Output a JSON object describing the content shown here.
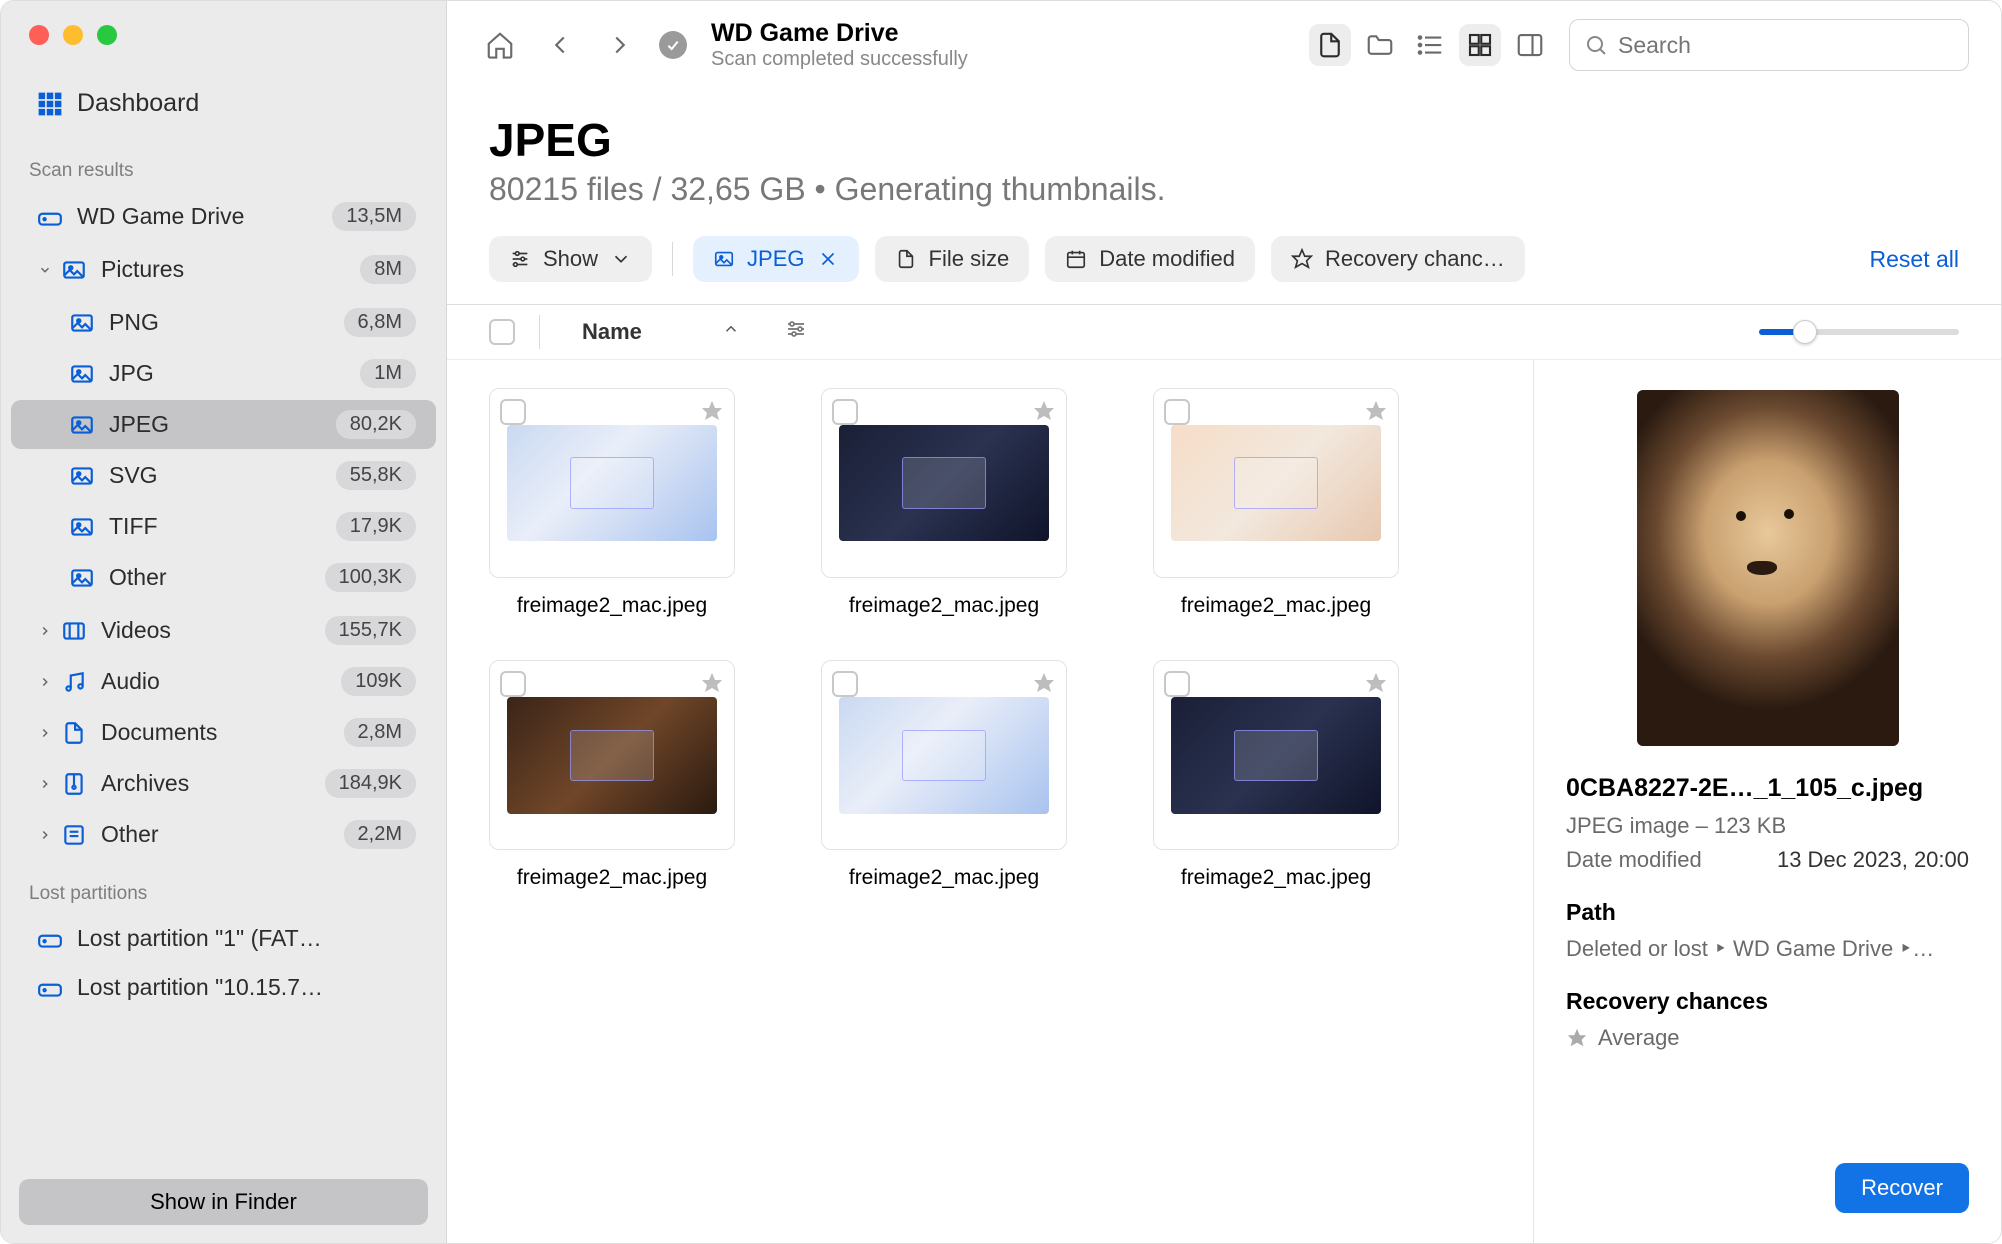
{
  "sidebar": {
    "dashboard": "Dashboard",
    "section_scan": "Scan results",
    "scan_drive": {
      "label": "WD Game Drive",
      "badge": "13,5M"
    },
    "pictures": {
      "label": "Pictures",
      "badge": "8M"
    },
    "pic_children": [
      {
        "label": "PNG",
        "badge": "6,8M"
      },
      {
        "label": "JPG",
        "badge": "1M"
      },
      {
        "label": "JPEG",
        "badge": "80,2K"
      },
      {
        "label": "SVG",
        "badge": "55,8K"
      },
      {
        "label": "TIFF",
        "badge": "17,9K"
      },
      {
        "label": "Other",
        "badge": "100,3K"
      }
    ],
    "categories": [
      {
        "label": "Videos",
        "badge": "155,7K"
      },
      {
        "label": "Audio",
        "badge": "109K"
      },
      {
        "label": "Documents",
        "badge": "2,8M"
      },
      {
        "label": "Archives",
        "badge": "184,9K"
      },
      {
        "label": "Other",
        "badge": "2,2M"
      }
    ],
    "section_lost": "Lost partitions",
    "lost": [
      "Lost partition \"1\" (FAT…",
      "Lost partition \"10.15.7…"
    ],
    "show_finder": "Show in Finder"
  },
  "toolbar": {
    "title": "WD Game Drive",
    "subtitle": "Scan completed successfully",
    "search_placeholder": "Search"
  },
  "header": {
    "title": "JPEG",
    "subtitle": "80215 files / 32,65 GB • Generating thumbnails."
  },
  "filters": {
    "show": "Show",
    "jpeg": "JPEG",
    "file_size": "File size",
    "date_modified": "Date modified",
    "recovery": "Recovery chanc…",
    "reset": "Reset all"
  },
  "list_header": {
    "name": "Name"
  },
  "files": [
    {
      "name": "freimage2_mac.jpeg",
      "variant": "light"
    },
    {
      "name": "freimage2_mac.jpeg",
      "variant": "dark"
    },
    {
      "name": "freimage2_mac.jpeg",
      "variant": "peach"
    },
    {
      "name": "freimage2_mac.jpeg",
      "variant": "orange"
    },
    {
      "name": "freimage2_mac.jpeg",
      "variant": "light"
    },
    {
      "name": "freimage2_mac.jpeg",
      "variant": "dark"
    }
  ],
  "preview": {
    "filename": "0CBA8227-2E…_1_105_c.jpeg",
    "meta": "JPEG image – 123 KB",
    "date_label": "Date modified",
    "date_value": "13 Dec 2023, 20:00",
    "path_label": "Path",
    "path_value": "Deleted or lost ‣ WD Game Drive ‣…",
    "chances_label": "Recovery chances",
    "chances_value": "Average",
    "recover": "Recover"
  }
}
